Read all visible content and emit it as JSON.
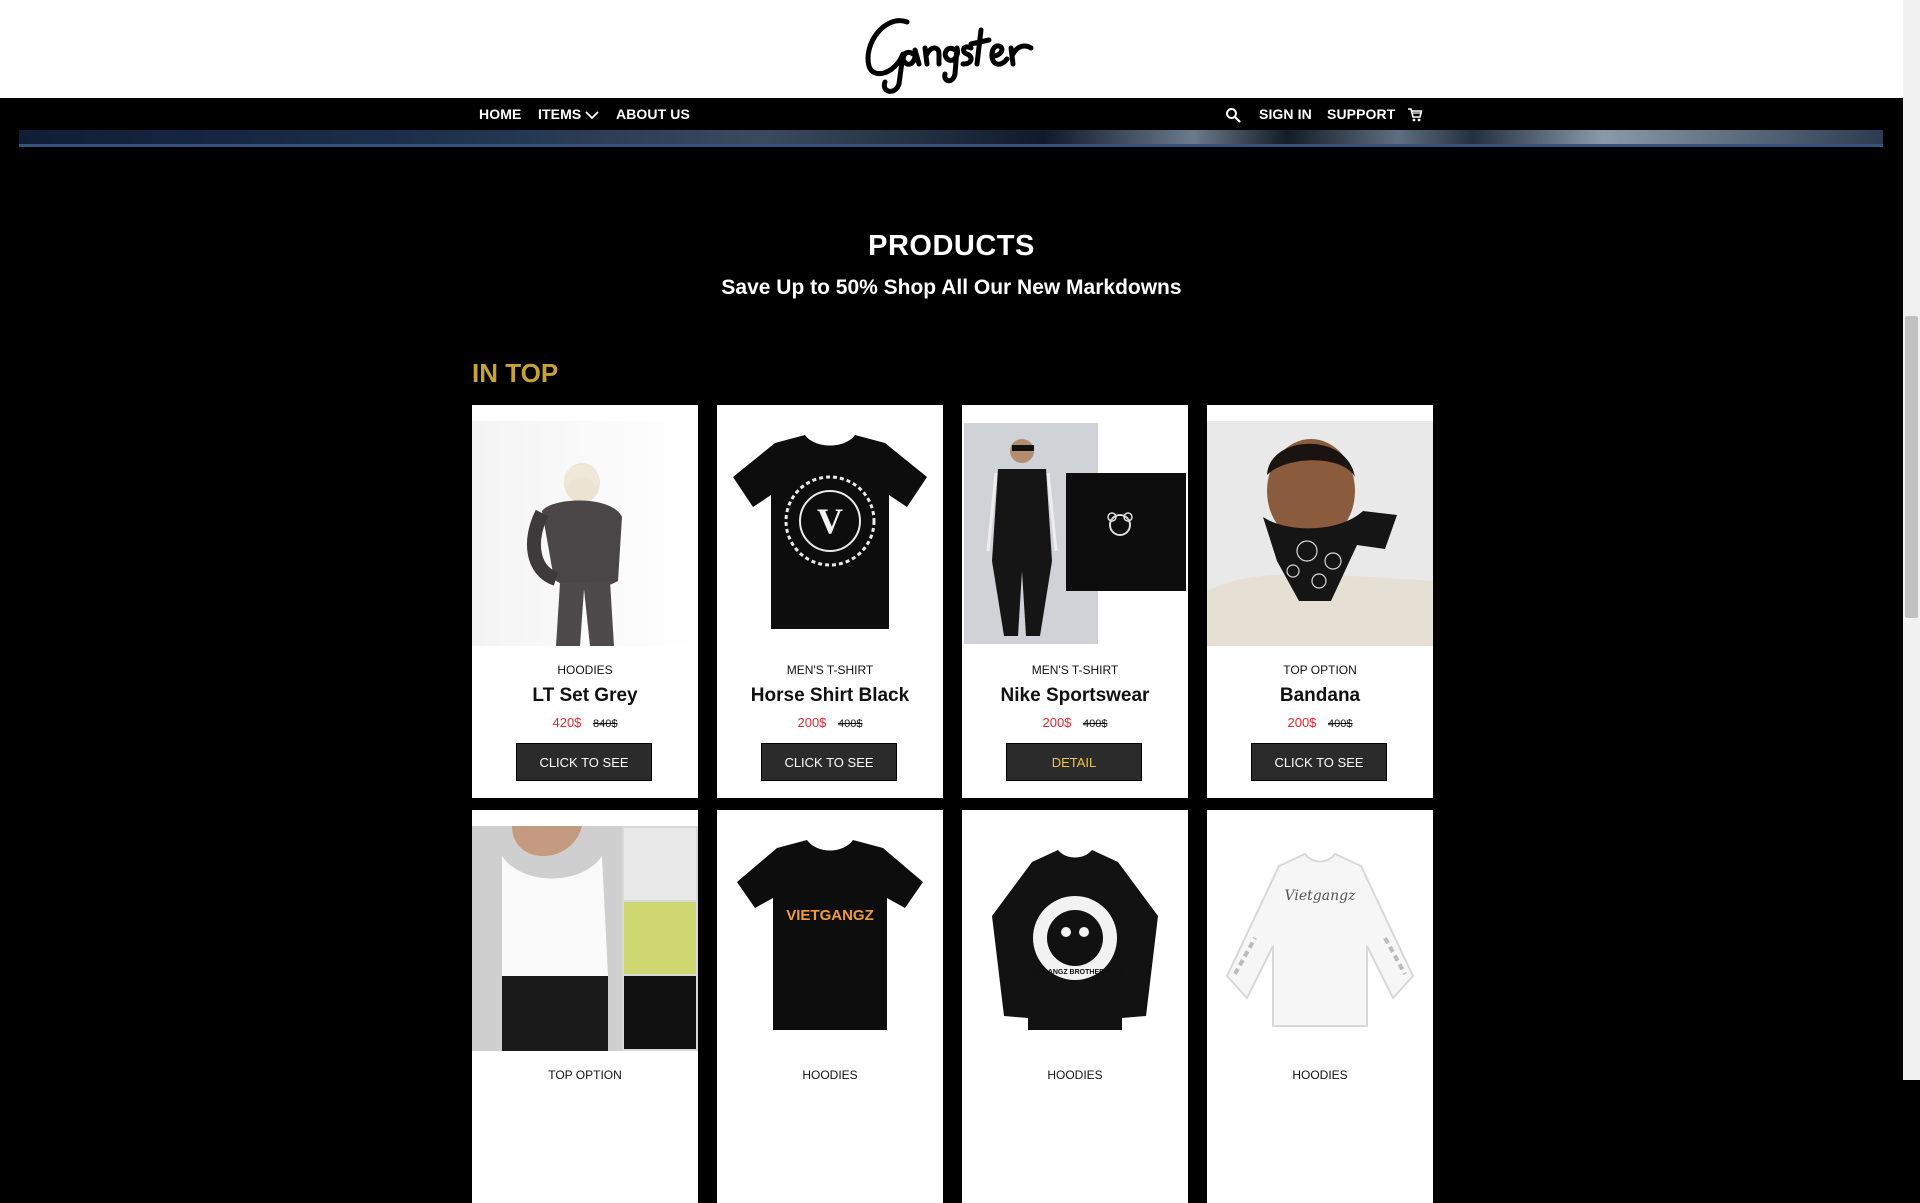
{
  "brand": {
    "logo_text": "Gangster"
  },
  "nav": {
    "home": "HOME",
    "items": "ITEMS",
    "about": "ABOUT US",
    "sign_in": "SIGN IN",
    "support": "SUPPORT",
    "icons": [
      "search-icon",
      "chevron-down-icon",
      "cart-icon"
    ]
  },
  "products": {
    "title": "PRODUCTS",
    "subtitle": "Save Up to 50% Shop All Our New Markdowns",
    "section_label": "IN TOP",
    "cards": [
      {
        "category": "HOODIES",
        "name": "LT Set Grey",
        "price": "420$",
        "old_price": "840$",
        "button": "CLICK TO SEE"
      },
      {
        "category": "MEN'S T-SHIRT",
        "name": "Horse Shirt Black",
        "price": "200$",
        "old_price": "400$",
        "button": "CLICK TO SEE"
      },
      {
        "category": "MEN'S T-SHIRT",
        "name": "Nike Sportswear",
        "price": "200$",
        "old_price": "400$",
        "button": "DETAIL"
      },
      {
        "category": "TOP OPTION",
        "name": "Bandana",
        "price": "200$",
        "old_price": "400$",
        "button": "CLICK TO SEE"
      },
      {
        "category": "TOP OPTION",
        "image_text": ""
      },
      {
        "category": "HOODIES",
        "image_text": "VIETGANGZ"
      },
      {
        "category": "HOODIES",
        "image_text": "VIET GANGZ BROTHERHOOD"
      },
      {
        "category": "HOODIES",
        "image_text": "Vietgangz"
      }
    ]
  },
  "colors": {
    "accent_gold": "#c9a235",
    "price_red": "#e3262c",
    "button_bg": "#2b2b2b",
    "button_hover_text": "#f0c34a"
  }
}
